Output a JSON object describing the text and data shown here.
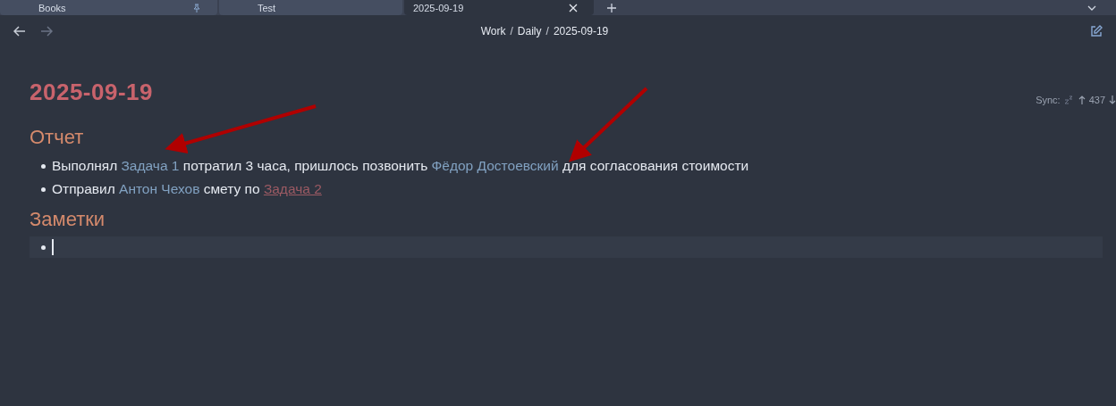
{
  "tabs": [
    {
      "title": "Books",
      "selected": false,
      "pinned": true
    },
    {
      "title": "Test",
      "selected": false,
      "pinned": false
    },
    {
      "title": "2025-09-19",
      "selected": true,
      "pinned": false
    }
  ],
  "breadcrumb": {
    "separator": "/",
    "items": [
      "Work",
      "Daily",
      "2025-09-19"
    ]
  },
  "sync": {
    "label": "Sync:",
    "count": "437"
  },
  "note": {
    "title": "2025-09-19",
    "sections": [
      {
        "heading": "Отчет",
        "bullets": [
          {
            "cursor": false,
            "segments": [
              {
                "kind": "text",
                "text": "Выполнял "
              },
              {
                "kind": "link",
                "text": "Задача 1"
              },
              {
                "kind": "text",
                "text": " потратил 3 часа, пришлось позвонить "
              },
              {
                "kind": "link",
                "text": "Фёдор Достоевский"
              },
              {
                "kind": "text",
                "text": " для согласования стоимости"
              }
            ]
          },
          {
            "cursor": false,
            "segments": [
              {
                "kind": "text",
                "text": "Отправил "
              },
              {
                "kind": "link",
                "text": "Антон Чехов"
              },
              {
                "kind": "text",
                "text": " смету по "
              },
              {
                "kind": "broken-link",
                "text": "Задача 2"
              }
            ]
          }
        ]
      },
      {
        "heading": "Заметки",
        "bullets": [
          {
            "cursor": true
          }
        ]
      }
    ]
  }
}
